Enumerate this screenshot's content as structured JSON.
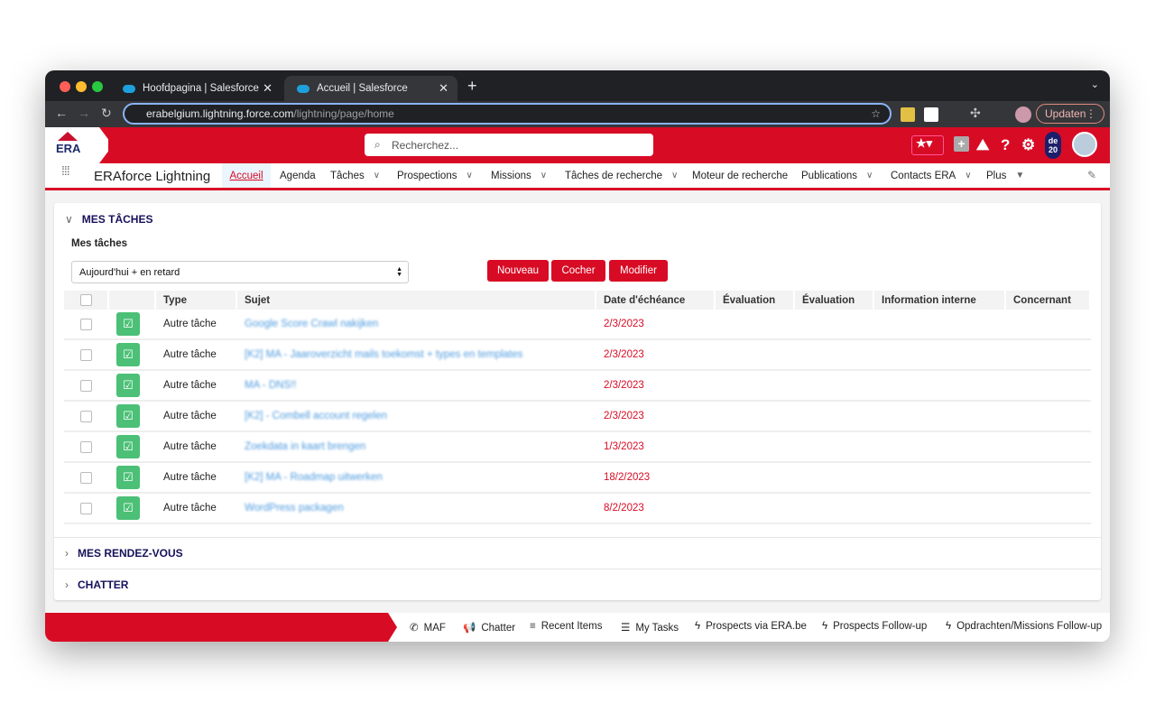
{
  "browser": {
    "tabs": [
      {
        "title": "Hoofdpagina | Salesforce"
      },
      {
        "title": "Accueil | Salesforce",
        "active": true
      }
    ],
    "url_host": "erabelgium.lightning.force.com",
    "url_path": "/lightning/page/home",
    "update_label": "Updaten"
  },
  "header": {
    "logo_text": "ERA",
    "search_placeholder": "Recherchez...",
    "badge": "de 20"
  },
  "nav": {
    "app_name": "ERAforce Lightning",
    "items": [
      {
        "label": "Accueil",
        "active": true
      },
      {
        "label": "Agenda"
      },
      {
        "label": "Tâches",
        "menu": true
      },
      {
        "label": "Prospections",
        "menu": true
      },
      {
        "label": "Missions",
        "menu": true
      },
      {
        "label": "Tâches de recherche",
        "menu": true
      },
      {
        "label": "Moteur de recherche"
      },
      {
        "label": "Publications",
        "menu": true
      },
      {
        "label": "Contacts ERA",
        "menu": true
      },
      {
        "label": "Plus",
        "menu": true
      }
    ]
  },
  "tasks": {
    "section_title": "MES TÂCHES",
    "list_title": "Mes tâches",
    "filter_value": "Aujourd'hui + en retard",
    "buttons": {
      "new": "Nouveau",
      "check": "Cocher",
      "edit": "Modifier"
    },
    "columns": [
      "Type",
      "Sujet",
      "Date d'échéance",
      "Évaluation",
      "Évaluation",
      "Information interne",
      "Concernant"
    ],
    "rows": [
      {
        "type": "Autre tâche",
        "subject": "Google Score Crawl nakijken",
        "due": "2/3/2023"
      },
      {
        "type": "Autre tâche",
        "subject": "[K2] MA - Jaaroverzicht mails toekomst + types en templates",
        "due": "2/3/2023"
      },
      {
        "type": "Autre tâche",
        "subject": "MA - DNS!!",
        "due": "2/3/2023"
      },
      {
        "type": "Autre tâche",
        "subject": "[K2] - Combell account regelen",
        "due": "2/3/2023"
      },
      {
        "type": "Autre tâche",
        "subject": "Zoekdata in kaart brengen",
        "due": "1/3/2023"
      },
      {
        "type": "Autre tâche",
        "subject": "[K2] MA - Roadmap uitwerken",
        "due": "18/2/2023"
      },
      {
        "type": "Autre tâche",
        "subject": "WordPress packagen",
        "due": "8/2/2023"
      }
    ]
  },
  "sections": {
    "appointments": "MES RENDEZ-VOUS",
    "chatter": "CHATTER"
  },
  "utility_bar": [
    {
      "label": "MAF",
      "icon": "phone-icon"
    },
    {
      "label": "Chatter",
      "icon": "megaphone-icon"
    },
    {
      "label": "Recent Items",
      "icon": "list-icon"
    },
    {
      "label": "My Tasks",
      "icon": "tasks-icon"
    },
    {
      "label": "Prospects via ERA.be",
      "icon": "bolt-icon"
    },
    {
      "label": "Prospects Follow-up",
      "icon": "bolt-icon"
    },
    {
      "label": "Opdrachten/Missions Follow-up",
      "icon": "bolt-icon"
    }
  ],
  "colors": {
    "brand": "#d80b25",
    "task_icon": "#4bc076",
    "section_title": "#16125a"
  }
}
